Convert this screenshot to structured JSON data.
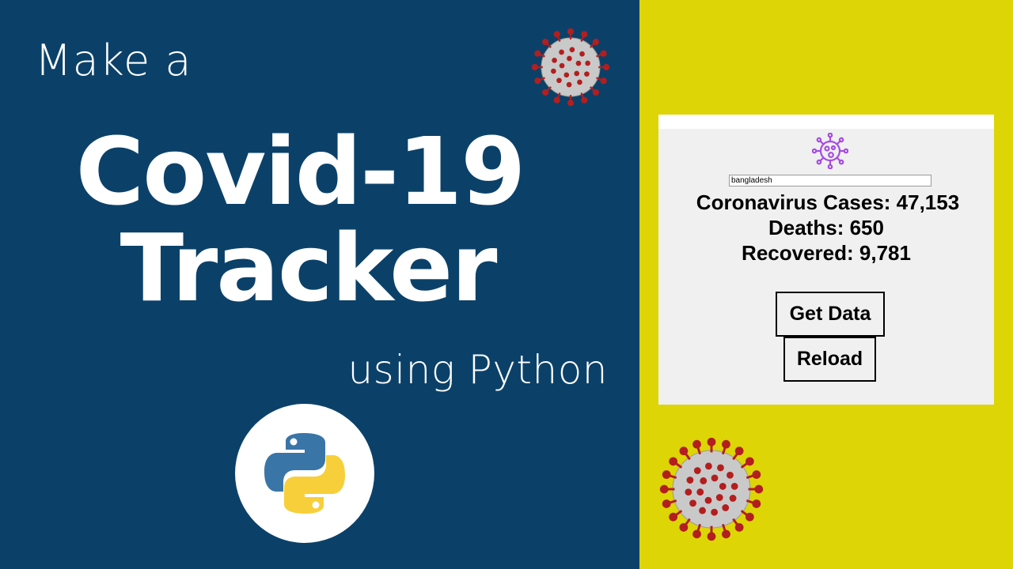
{
  "thumbnail": {
    "intro": "Make a",
    "headline_line1": "Covid-19",
    "headline_line2": "Tracker",
    "subtitle": "using Python"
  },
  "colors": {
    "left_background": "#0b4169",
    "right_background": "#ddd505",
    "window_background": "#f0f0f0",
    "virus_body": "#c9c9c9",
    "virus_spike": "#b31e1e",
    "python_blue": "#3a75a8",
    "python_yellow": "#f7cf3a",
    "app_icon": "#a64de0"
  },
  "icons": {
    "virus_top": "coronavirus-icon",
    "virus_bottom": "coronavirus-icon",
    "python_logo": "python-logo",
    "app_icon": "virus-outline-icon"
  },
  "app": {
    "search": {
      "value": "bangladesh"
    },
    "cases_line": "Coronavirus Cases: 47,153",
    "deaths_line": "Deaths: 650",
    "recovered_line": "Recovered: 9,781",
    "get_data_label": "Get Data",
    "reload_label": "Reload"
  }
}
